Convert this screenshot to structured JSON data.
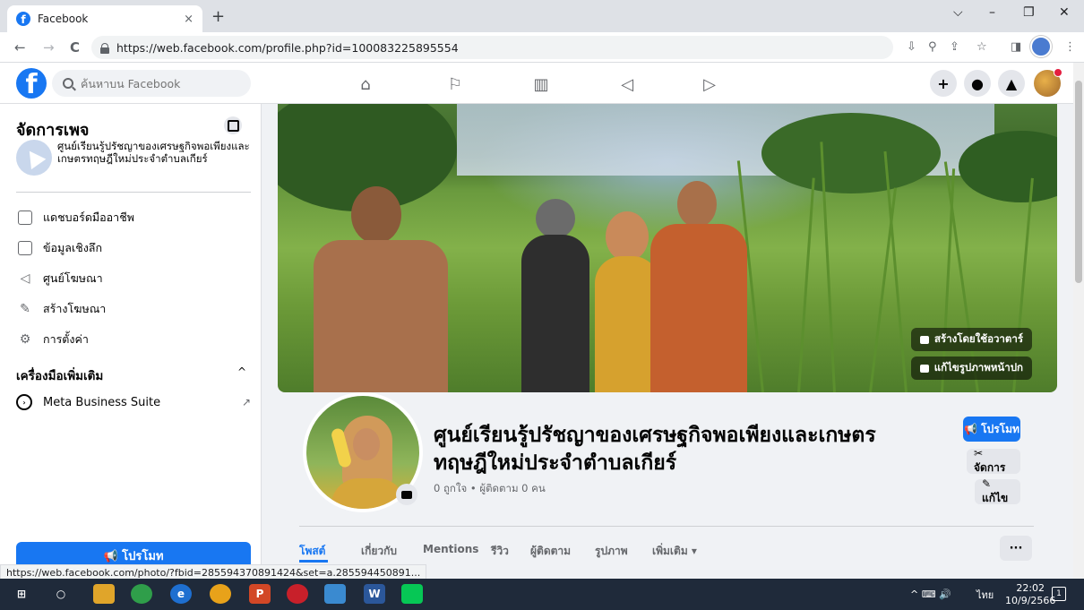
{
  "browser": {
    "tab_title": "Facebook",
    "tab_close": "×",
    "new_tab": "+",
    "url": "https://web.facebook.com/profile.php?id=100083225895554",
    "win_minimize": "–",
    "win_restore": "❐",
    "win_close": "✕",
    "win_dropdown": "⌵",
    "back": "←",
    "forward": "→",
    "reload": "C",
    "status_url": "https://web.facebook.com/photo/?fbid=285594370891424&set=a.285594450891..."
  },
  "fb": {
    "logo": "f",
    "search_placeholder": "ค้นหาบน Facebook",
    "create_button": "+"
  },
  "sidebar": {
    "title": "จัดการเพจ",
    "page_name": "ศูนย์เรียนรู้ปรัชญาของเศรษฐกิจพอเพียงและเกษตรทฤษฎีใหม่ประจำตำบลเกียร์",
    "items": [
      {
        "label": "แดชบอร์ดมืออาชีพ",
        "icon": "dashboard-icon"
      },
      {
        "label": "ข้อมูลเชิงลึก",
        "icon": "insights-icon"
      },
      {
        "label": "ศูนย์โฆษณา",
        "icon": "megaphone-icon"
      },
      {
        "label": "สร้างโฆษณา",
        "icon": "pencil-icon"
      },
      {
        "label": "การตั้งค่า",
        "icon": "gear-icon"
      }
    ],
    "section_title": "เครื่องมือเพิ่มเติม",
    "section_caret": "^",
    "meta_suite": "Meta Business Suite",
    "meta_ext": "↗",
    "promote": "📢 โปรโมท"
  },
  "cover": {
    "avatar_button": "สร้างโดยใช้อวาตาร์",
    "edit_cover_button": "แก้ไขรูปภาพหน้าปก"
  },
  "profile": {
    "name": "ศูนย์เรียนรู้ปรัชญาของเศรษฐกิจพอเพียงและเกษตรทฤษฎีใหม่ประจำตำบลเกียร์",
    "stats": "0 ถูกใจ • ผู้ติดตาม 0 คน",
    "promote": "📢 โปรโมท",
    "manage": "✂ จัดการ",
    "edit": "✎ แก้ไข"
  },
  "tabs": [
    {
      "label": "โพสต์",
      "active": true
    },
    {
      "label": "เกี่ยวกับ"
    },
    {
      "label": "Mentions"
    },
    {
      "label": "รีวิว"
    },
    {
      "label": "ผู้ติดตาม"
    },
    {
      "label": "รูปภาพ"
    },
    {
      "label": "เพิ่มเติม ▾"
    }
  ],
  "more_dots": "···",
  "taskbar": {
    "tray": "^  ⌨  🔊",
    "lang": "ไทย",
    "time": "22:02",
    "date": "10/9/2566",
    "notif_count": "1"
  }
}
